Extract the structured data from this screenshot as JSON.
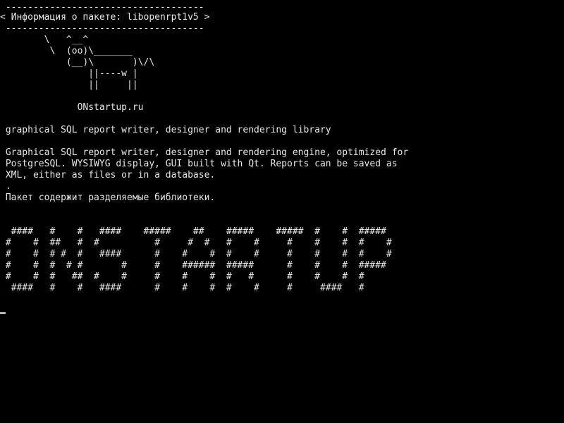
{
  "terminal": {
    "lines": [
      " ------------------------------------",
      "< Информация о пакете: libopenrpt1v5 >",
      " ------------------------------------",
      "        \\   ^__^",
      "         \\  (oo)\\_______",
      "            (__)\\       )\\/\\",
      "                ||----w |",
      "                ||     ||",
      "",
      "              ONstartup.ru",
      "",
      " graphical SQL report writer, designer and rendering library",
      "",
      " Graphical SQL report writer, designer and rendering engine, optimized for",
      " PostgreSQL. WYSIWYG display, GUI built with Qt. Reports can be saved as",
      " XML, either as files or in a database.",
      " .",
      " Пакет содержит разделяемые библиотеки.",
      "",
      "",
      "  ####   #    #   ####    #####    ##    #####    #####  #    #  #####",
      " #    #  ##   #  #          #     #  #   #    #     #    #    #  #    #",
      " #    #  # #  #   ####      #    #    #  #    #     #    #    #  #    #",
      " #    #  #  # #       #     #    ######  #####      #    #    #  #####",
      " #    #  #   ##  #    #     #    #    #  #   #      #    #    #  #",
      "  ####   #    #   ####      #    #    #  #    #     #     ####   #"
    ]
  }
}
